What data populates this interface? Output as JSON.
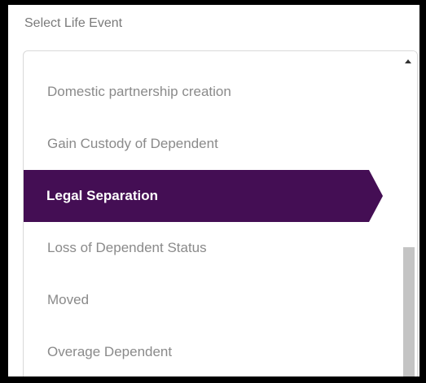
{
  "field": {
    "label": "Select Life Event"
  },
  "listbox": {
    "options": [
      {
        "label": "Domestic partnership creation",
        "selected": false
      },
      {
        "label": "Gain Custody of Dependent",
        "selected": false
      },
      {
        "label": "Legal Separation",
        "selected": true
      },
      {
        "label": "Loss of Dependent Status",
        "selected": false
      },
      {
        "label": "Moved",
        "selected": false
      },
      {
        "label": "Overage Dependent",
        "selected": false
      }
    ],
    "selected_color": "#440e54",
    "scroll_position": 0.59
  },
  "scrollbar": {
    "up_icon": "triangle-up-icon"
  }
}
